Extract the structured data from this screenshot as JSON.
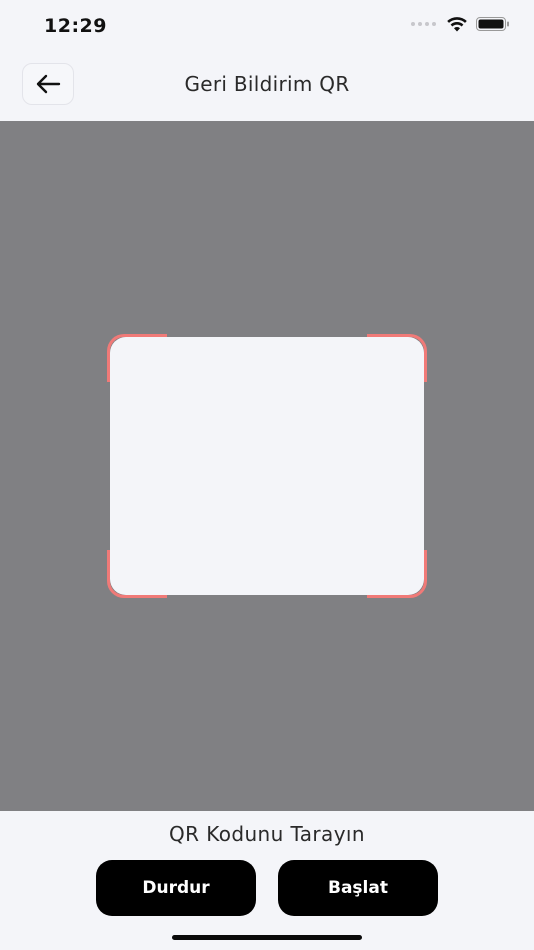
{
  "status_bar": {
    "time": "12:29",
    "icons": [
      "signal-dots-icon",
      "wifi-icon",
      "battery-icon"
    ]
  },
  "header": {
    "title": "Geri Bildirim QR",
    "back_icon": "arrow-left-icon"
  },
  "scanner": {
    "frame_color": "#F07A78",
    "camera_bg": "#808083"
  },
  "footer": {
    "instruction": "QR Kodunu Tarayın",
    "stop_label": "Durdur",
    "start_label": "Başlat"
  },
  "colors": {
    "background": "#F4F5F9",
    "button_bg": "#000000",
    "button_text": "#FFFFFF"
  }
}
